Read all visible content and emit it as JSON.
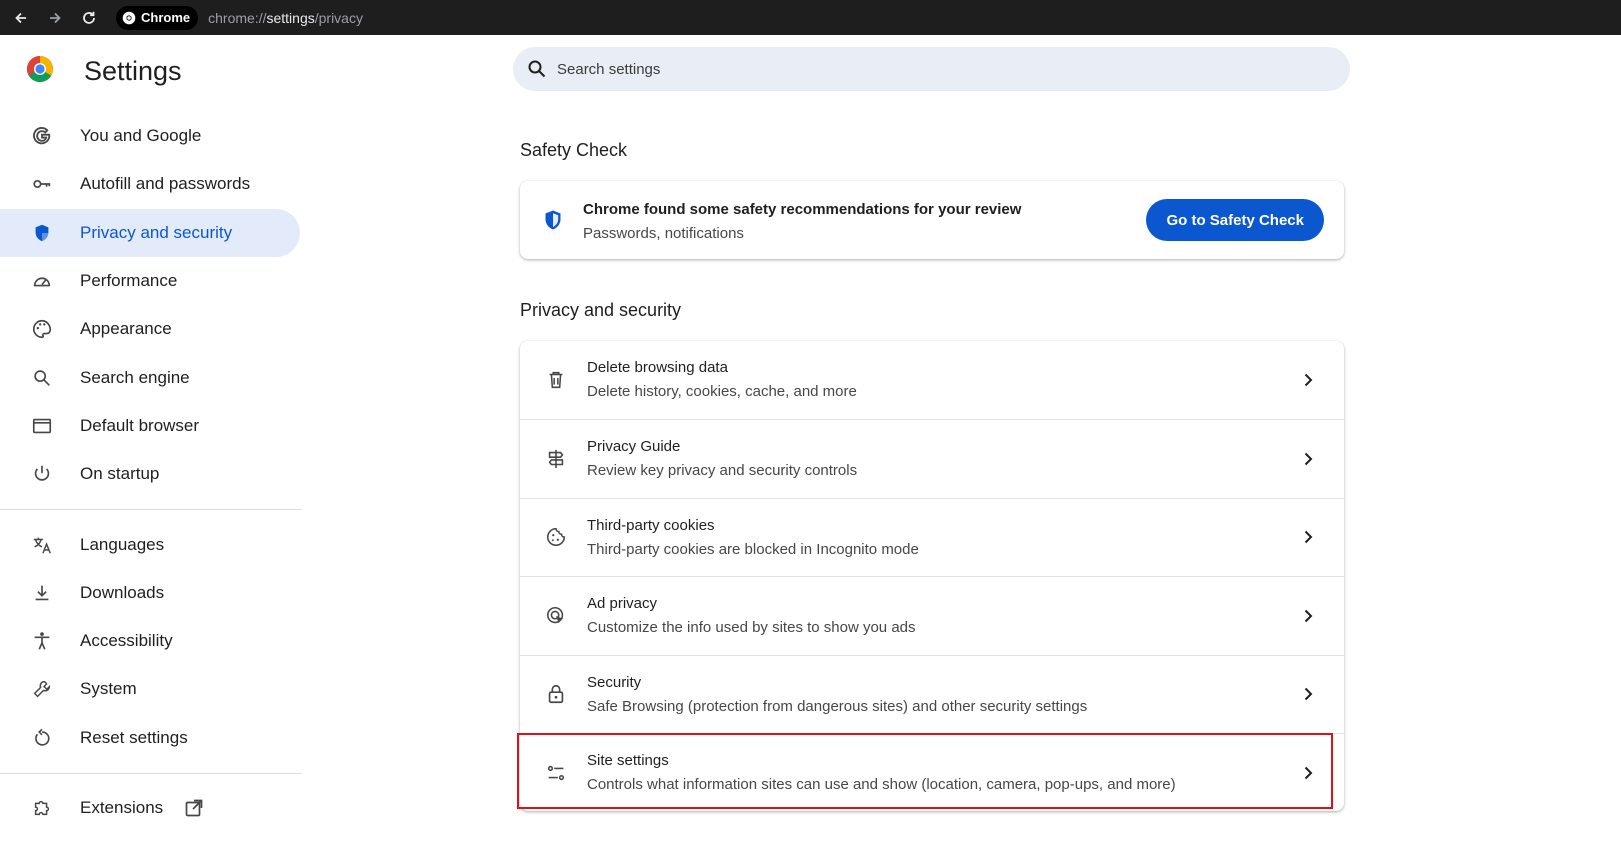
{
  "browser": {
    "chip_label": "Chrome",
    "url_prefix": "chrome://",
    "url_strong": "settings",
    "url_suffix": "/privacy"
  },
  "sidebar": {
    "title": "Settings",
    "items": [
      {
        "label": "You and Google",
        "icon": "google-g-icon"
      },
      {
        "label": "Autofill and passwords",
        "icon": "key-icon"
      },
      {
        "label": "Privacy and security",
        "icon": "shield-icon",
        "active": true
      },
      {
        "label": "Performance",
        "icon": "speedometer-icon"
      },
      {
        "label": "Appearance",
        "icon": "palette-icon"
      },
      {
        "label": "Search engine",
        "icon": "search-icon"
      },
      {
        "label": "Default browser",
        "icon": "browser-window-icon"
      },
      {
        "label": "On startup",
        "icon": "power-icon"
      }
    ],
    "items2": [
      {
        "label": "Languages",
        "icon": "translate-icon"
      },
      {
        "label": "Downloads",
        "icon": "download-icon"
      },
      {
        "label": "Accessibility",
        "icon": "accessibility-icon"
      },
      {
        "label": "System",
        "icon": "wrench-icon"
      },
      {
        "label": "Reset settings",
        "icon": "reset-icon"
      }
    ],
    "items3": [
      {
        "label": "Extensions",
        "icon": "puzzle-icon"
      }
    ]
  },
  "search": {
    "placeholder": "Search settings"
  },
  "safety_check": {
    "section_title": "Safety Check",
    "title": "Chrome found some safety recommendations for your review",
    "subtitle": "Passwords, notifications",
    "button": "Go to Safety Check"
  },
  "privacy": {
    "section_title": "Privacy and security",
    "rows": [
      {
        "title": "Delete browsing data",
        "subtitle": "Delete history, cookies, cache, and more",
        "icon": "trash-icon"
      },
      {
        "title": "Privacy Guide",
        "subtitle": "Review key privacy and security controls",
        "icon": "signpost-icon"
      },
      {
        "title": "Third-party cookies",
        "subtitle": "Third-party cookies are blocked in Incognito mode",
        "icon": "cookie-icon"
      },
      {
        "title": "Ad privacy",
        "subtitle": "Customize the info used by sites to show you ads",
        "icon": "ad-privacy-icon"
      },
      {
        "title": "Security",
        "subtitle": "Safe Browsing (protection from dangerous sites) and other security settings",
        "icon": "lock-icon"
      },
      {
        "title": "Site settings",
        "subtitle": "Controls what information sites can use and show (location, camera, pop-ups, and more)",
        "icon": "sliders-icon"
      }
    ]
  },
  "colors": {
    "accent": "#0b57d0",
    "active_bg": "#e3ebfb",
    "highlight_border": "#e0101a"
  }
}
